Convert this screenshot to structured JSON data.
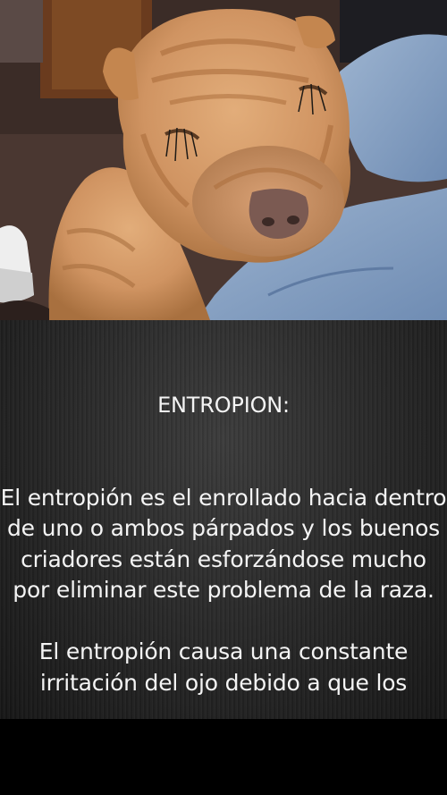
{
  "story": {
    "heading": "ENTROPION:",
    "paragraphs": [
      "El entropión es el enrollado hacia dentro de uno o ambos párpados y los buenos criadores están esforzándose mucho por eliminar este problema de la raza.",
      "El entropión causa una constante irritación del ojo debido a que los"
    ]
  },
  "photo": {
    "subject": "shar-pei-puppy-image"
  },
  "colors": {
    "text": "#f4f4f4",
    "panel_background": "#2a2a2a",
    "bottom_bar": "#000000"
  }
}
